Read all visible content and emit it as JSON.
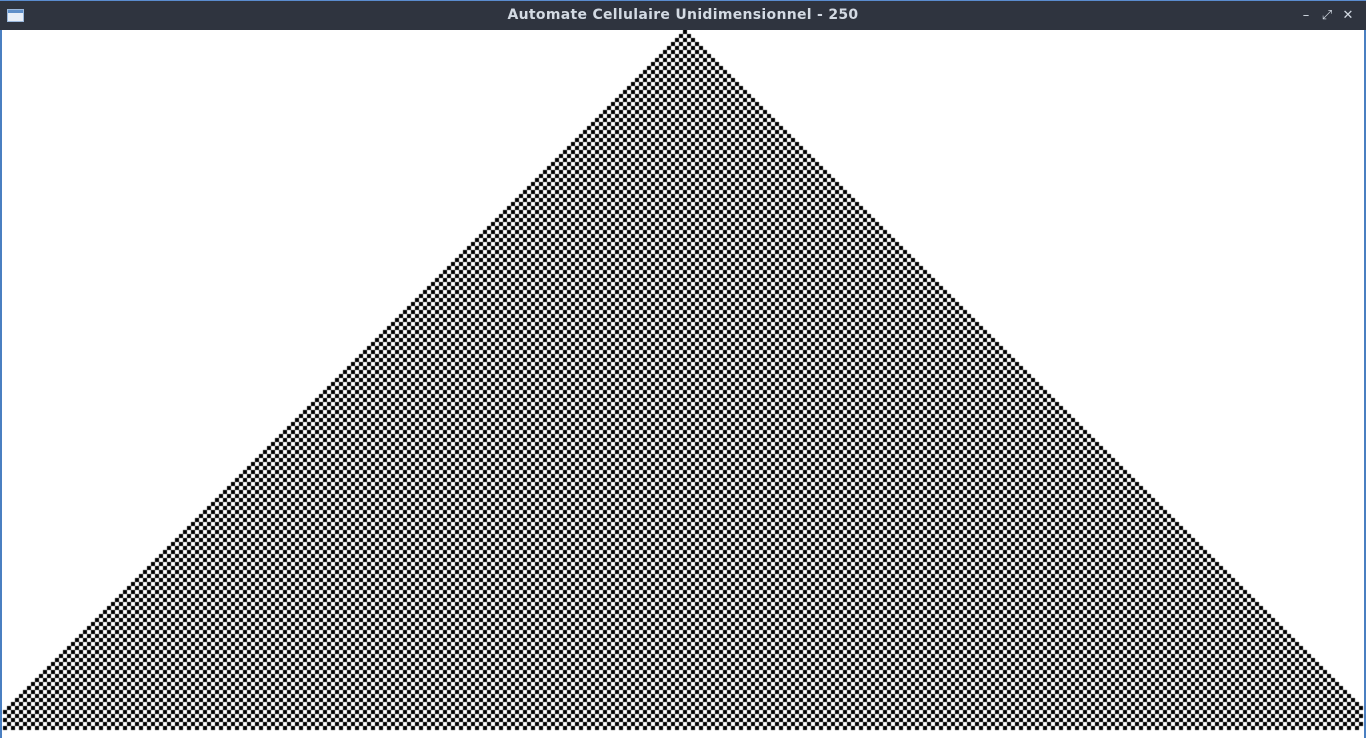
{
  "window": {
    "title": "Automate Cellulaire Unidimensionnel - 250",
    "minimize_icon": "minimize-icon",
    "maximize_icon": "maximize-icon",
    "close_icon": "close-icon"
  },
  "automaton": {
    "rule": 250,
    "generations_visible": 175,
    "alive_color": "#000000",
    "dead_color": "#ffffff"
  }
}
